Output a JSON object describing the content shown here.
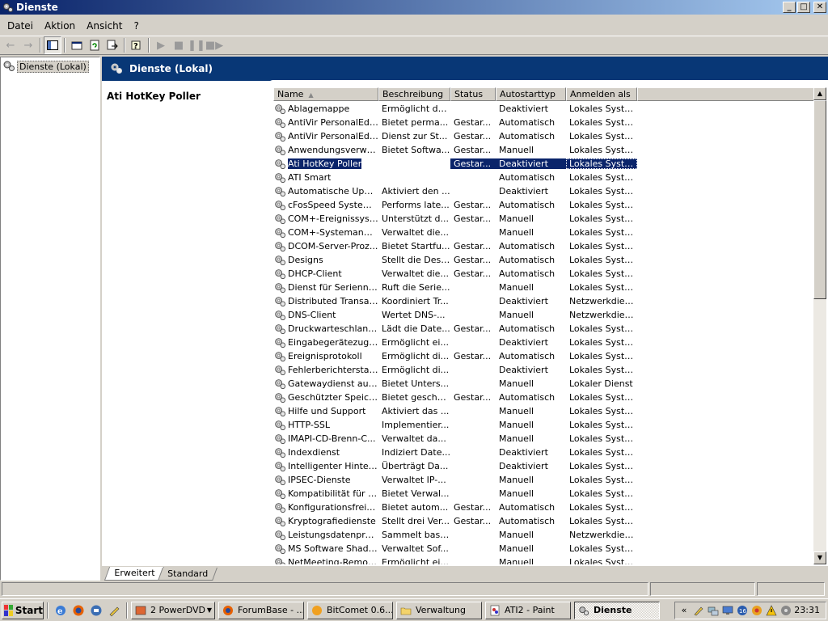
{
  "window": {
    "title": "Dienste",
    "minimize": "_",
    "maximize": "□",
    "close": "✕"
  },
  "menu": [
    {
      "label": "Datei",
      "key": "D"
    },
    {
      "label": "Aktion",
      "key": "k"
    },
    {
      "label": "Ansicht",
      "key": "A"
    },
    {
      "label": "?",
      "key": "?"
    }
  ],
  "toolbar": {
    "back_icon": "back-arrow-icon",
    "forward_icon": "forward-arrow-icon"
  },
  "tree": {
    "root_label": "Dienste (Lokal)"
  },
  "banner": {
    "title": "Dienste (Lokal)"
  },
  "detail": {
    "title": "Ati HotKey Poller"
  },
  "list": {
    "columns": [
      "Name",
      "Beschreibung",
      "Status",
      "Autostarttyp",
      "Anmelden als"
    ],
    "sorted_column": "Name",
    "selected_index": 4,
    "rows": [
      {
        "name": "Ablagemappe",
        "desc": "Ermöglicht de...",
        "status": "",
        "start": "Deaktiviert",
        "logon": "Lokales System"
      },
      {
        "name": "AntiVir PersonalEditi...",
        "desc": "Bietet perma...",
        "status": "Gestar...",
        "start": "Automatisch",
        "logon": "Lokales System"
      },
      {
        "name": "AntiVir PersonalEditi...",
        "desc": "Dienst zur St...",
        "status": "Gestar...",
        "start": "Automatisch",
        "logon": "Lokales System"
      },
      {
        "name": "Anwendungsverwal...",
        "desc": "Bietet Softwa...",
        "status": "Gestar...",
        "start": "Manuell",
        "logon": "Lokales System"
      },
      {
        "name": "Ati HotKey Poller",
        "desc": "",
        "status": "Gestar...",
        "start": "Deaktiviert",
        "logon": "Lokales System"
      },
      {
        "name": "ATI Smart",
        "desc": "",
        "status": "",
        "start": "Automatisch",
        "logon": "Lokales System"
      },
      {
        "name": "Automatische Updates",
        "desc": "Aktiviert den ...",
        "status": "",
        "start": "Deaktiviert",
        "logon": "Lokales System"
      },
      {
        "name": "cFosSpeed System ...",
        "desc": "Performs late...",
        "status": "Gestar...",
        "start": "Automatisch",
        "logon": "Lokales System"
      },
      {
        "name": "COM+-Ereignissystem",
        "desc": "Unterstützt d...",
        "status": "Gestar...",
        "start": "Manuell",
        "logon": "Lokales System"
      },
      {
        "name": "COM+-Systemanwe...",
        "desc": "Verwaltet die...",
        "status": "",
        "start": "Manuell",
        "logon": "Lokales System"
      },
      {
        "name": "DCOM-Server-Proz...",
        "desc": "Bietet Startfu...",
        "status": "Gestar...",
        "start": "Automatisch",
        "logon": "Lokales System"
      },
      {
        "name": "Designs",
        "desc": "Stellt die Desi...",
        "status": "Gestar...",
        "start": "Automatisch",
        "logon": "Lokales System"
      },
      {
        "name": "DHCP-Client",
        "desc": "Verwaltet die...",
        "status": "Gestar...",
        "start": "Automatisch",
        "logon": "Lokales System"
      },
      {
        "name": "Dienst für Seriennu...",
        "desc": "Ruft die Serie...",
        "status": "",
        "start": "Manuell",
        "logon": "Lokales System"
      },
      {
        "name": "Distributed Transac...",
        "desc": "Koordiniert Tr...",
        "status": "",
        "start": "Deaktiviert",
        "logon": "Netzwerkdienst"
      },
      {
        "name": "DNS-Client",
        "desc": "Wertet DNS-...",
        "status": "",
        "start": "Manuell",
        "logon": "Netzwerkdienst"
      },
      {
        "name": "Druckwarteschlange",
        "desc": "Lädt die Date...",
        "status": "Gestar...",
        "start": "Automatisch",
        "logon": "Lokales System"
      },
      {
        "name": "Eingabegerätezugang",
        "desc": "Ermöglicht ei...",
        "status": "",
        "start": "Deaktiviert",
        "logon": "Lokales System"
      },
      {
        "name": "Ereignisprotokoll",
        "desc": "Ermöglicht di...",
        "status": "Gestar...",
        "start": "Automatisch",
        "logon": "Lokales System"
      },
      {
        "name": "Fehlerberichterstatt...",
        "desc": "Ermöglicht di...",
        "status": "",
        "start": "Deaktiviert",
        "logon": "Lokales System"
      },
      {
        "name": "Gatewaydienst auf ...",
        "desc": "Bietet Unters...",
        "status": "",
        "start": "Manuell",
        "logon": "Lokaler Dienst"
      },
      {
        "name": "Geschützter Speicher",
        "desc": "Bietet geschü...",
        "status": "Gestar...",
        "start": "Automatisch",
        "logon": "Lokales System"
      },
      {
        "name": "Hilfe und Support",
        "desc": "Aktiviert das ...",
        "status": "",
        "start": "Manuell",
        "logon": "Lokales System"
      },
      {
        "name": "HTTP-SSL",
        "desc": "Implementier...",
        "status": "",
        "start": "Manuell",
        "logon": "Lokales System"
      },
      {
        "name": "IMAPI-CD-Brenn-C...",
        "desc": "Verwaltet da...",
        "status": "",
        "start": "Manuell",
        "logon": "Lokales System"
      },
      {
        "name": "Indexdienst",
        "desc": "Indiziert Date...",
        "status": "",
        "start": "Deaktiviert",
        "logon": "Lokales System"
      },
      {
        "name": "Intelligenter Hinterg...",
        "desc": "Überträgt Da...",
        "status": "",
        "start": "Deaktiviert",
        "logon": "Lokales System"
      },
      {
        "name": "IPSEC-Dienste",
        "desc": "Verwaltet IP-...",
        "status": "",
        "start": "Manuell",
        "logon": "Lokales System"
      },
      {
        "name": "Kompatibilität für sc...",
        "desc": "Bietet Verwal...",
        "status": "",
        "start": "Manuell",
        "logon": "Lokales System"
      },
      {
        "name": "Konfigurationsfreie ...",
        "desc": "Bietet autom...",
        "status": "Gestar...",
        "start": "Automatisch",
        "logon": "Lokales System"
      },
      {
        "name": "Kryptografiedienste",
        "desc": "Stellt drei Ver...",
        "status": "Gestar...",
        "start": "Automatisch",
        "logon": "Lokales System"
      },
      {
        "name": "Leistungsdatenprot...",
        "desc": "Sammelt basi...",
        "status": "",
        "start": "Manuell",
        "logon": "Netzwerkdienst"
      },
      {
        "name": "MS Software Shado...",
        "desc": "Verwaltet Sof...",
        "status": "",
        "start": "Manuell",
        "logon": "Lokales System"
      },
      {
        "name": "NetMeeting-Remote...",
        "desc": "Ermöglicht ei...",
        "status": "",
        "start": "Manuell",
        "logon": "Lokales System"
      }
    ]
  },
  "tabs": [
    {
      "label": "Erweitert",
      "active": true
    },
    {
      "label": "Standard",
      "active": false
    }
  ],
  "taskbar": {
    "start_label": "Start",
    "tasks": [
      {
        "label": "2 PowerDVD",
        "icon": "powerdvd-icon",
        "group": true,
        "active": false
      },
      {
        "label": "ForumBase - ...",
        "icon": "firefox-icon",
        "group": false,
        "active": false
      },
      {
        "label": "BitComet 0.6...",
        "icon": "bitcomet-icon",
        "group": false,
        "active": false
      },
      {
        "label": "Verwaltung",
        "icon": "folder-icon",
        "group": false,
        "active": false
      },
      {
        "label": "ATI2 - Paint",
        "icon": "paint-icon",
        "group": false,
        "active": false
      },
      {
        "label": "Dienste",
        "icon": "services-icon",
        "group": false,
        "active": true
      }
    ],
    "clock": "23:31",
    "tray_expand": "«"
  }
}
